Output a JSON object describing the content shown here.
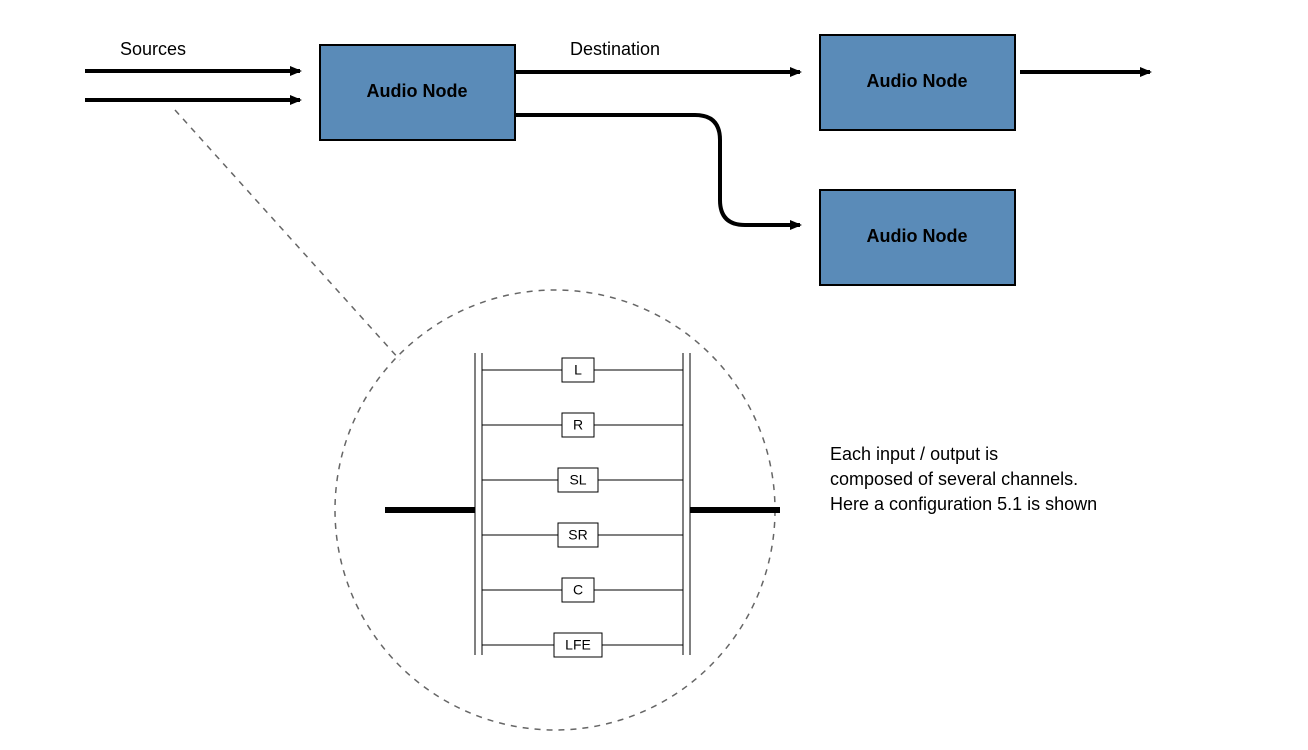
{
  "labels": {
    "sources": "Sources",
    "destination": "Destination"
  },
  "nodes": {
    "central": "Audio Node",
    "upperRight": "Audio Node",
    "lowerRight": "Audio Node"
  },
  "channels": {
    "c0": "L",
    "c1": "R",
    "c2": "SL",
    "c3": "SR",
    "c4": "C",
    "c5": "LFE"
  },
  "description": {
    "line1": "Each input / output is",
    "line2": "composed of several channels.",
    "line3": "Here a configuration 5.1 is shown"
  },
  "colors": {
    "node_fill": "#5a8bb8",
    "stroke": "#000000"
  }
}
